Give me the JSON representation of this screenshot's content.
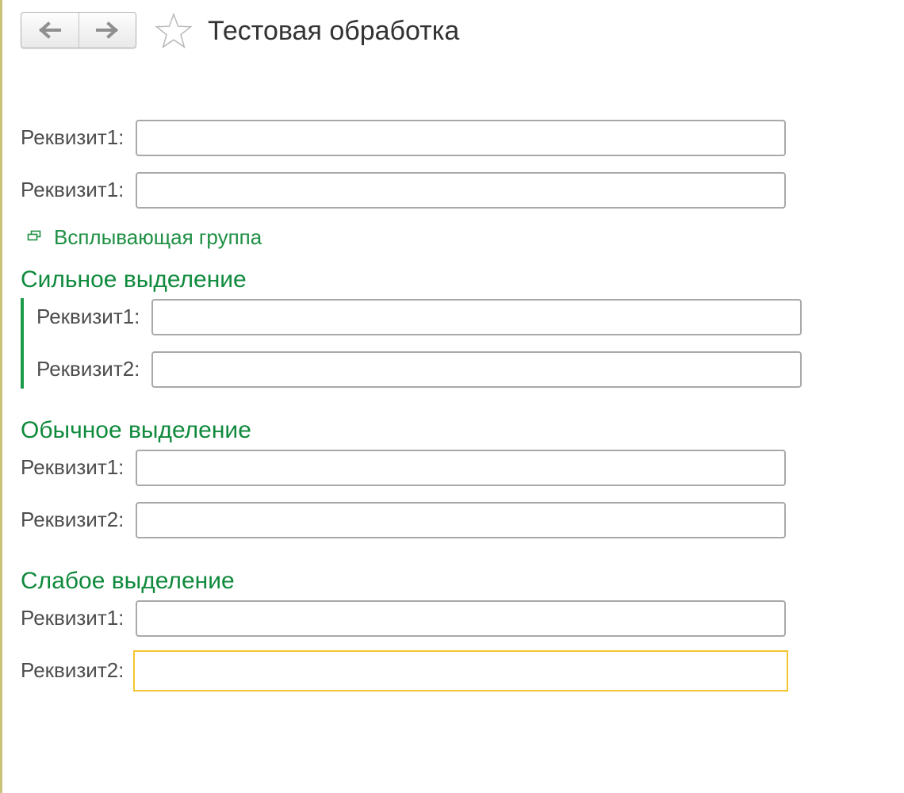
{
  "header": {
    "title": "Тестовая обработка",
    "back_icon": "arrow-left-icon",
    "forward_icon": "arrow-right-icon",
    "favorite_icon": "star-outline-icon"
  },
  "fields_top": [
    {
      "label": "Реквизит1:",
      "value": ""
    },
    {
      "label": "Реквизит1:",
      "value": ""
    }
  ],
  "popup_group": {
    "label": "Всплывающая группа",
    "icon": "popup-group-icon"
  },
  "groups": [
    {
      "title": "Сильное выделение",
      "fields": [
        {
          "label": "Реквизит1:",
          "value": ""
        },
        {
          "label": "Реквизит2:",
          "value": ""
        }
      ]
    },
    {
      "title": "Обычное выделение",
      "fields": [
        {
          "label": "Реквизит1:",
          "value": ""
        },
        {
          "label": "Реквизит2:",
          "value": ""
        }
      ]
    },
    {
      "title": "Слабое выделение",
      "fields": [
        {
          "label": "Реквизит1:",
          "value": ""
        },
        {
          "label": "Реквизит2:",
          "value": ""
        }
      ]
    }
  ],
  "colors": {
    "accent_green": "#0f8a3c",
    "focus_border": "#f3c531",
    "input_border": "#a9a9a9",
    "label_text": "#4d4d4d"
  }
}
